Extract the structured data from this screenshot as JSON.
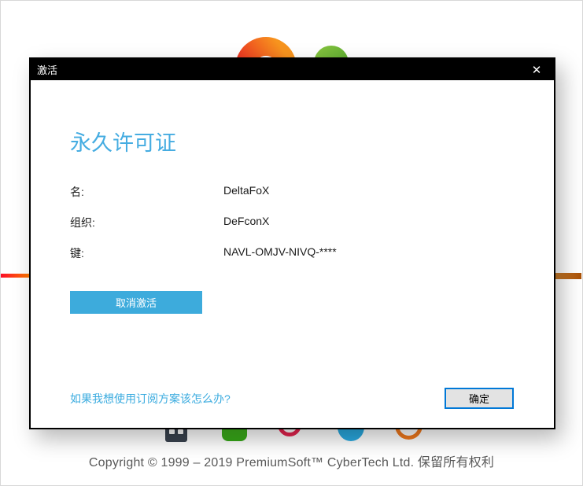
{
  "dialog": {
    "title": "激活",
    "close_glyph": "✕",
    "heading": "永久许可证",
    "fields": [
      {
        "label": "名:",
        "value": "DeltaFoX"
      },
      {
        "label": "组织:",
        "value": "DeFconX"
      },
      {
        "label": "键:",
        "value": "NAVL-OMJV-NIVQ-****"
      }
    ],
    "deactivate_label": "取消激活",
    "subscription_link": "如果我想使用订阅方案该怎么办?",
    "ok_label": "确定"
  },
  "background": {
    "copyright": "Copyright © 1999 – 2019 PremiumSoft™ CyberTech Ltd. 保留所有权利",
    "icons": [
      "brand-logo-ring-icon",
      "green-dot-icon",
      "camera-app-icon",
      "green-app-icon",
      "red-ring-app-icon",
      "blue-app-icon",
      "orange-ring-app-icon"
    ]
  },
  "colors": {
    "titlebar": "#000000",
    "heading_blue": "#45ace1",
    "deactivate_button_blue": "#3dabdc",
    "link_blue": "#3aabdf",
    "ok_border_blue": "#0078d7",
    "gradient_line_left": [
      "#fb0d28",
      "#ff7b00"
    ],
    "gradient_line_right": [
      "#c97c2b",
      "#ab5106"
    ],
    "copyright_gray": "#5a5a5a"
  }
}
